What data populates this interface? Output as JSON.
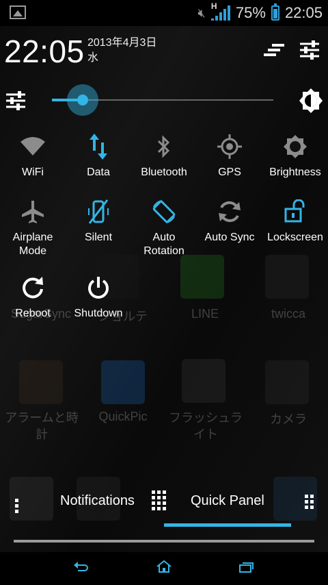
{
  "status_bar": {
    "battery_percent": "75%",
    "time": "22:05",
    "network_type": "H",
    "icons": [
      "gallery-icon",
      "muted-icon",
      "signal-icon",
      "battery-icon"
    ]
  },
  "header": {
    "clock": "22:05",
    "date": "2013年4月3日",
    "weekday": "水"
  },
  "brightness": {
    "level": 0.14,
    "icons": [
      "settings-sliders-icon",
      "brightness-auto-icon"
    ]
  },
  "toggles_row1": [
    {
      "label": "WiFi",
      "icon": "wifi-icon",
      "state": "off"
    },
    {
      "label": "Data",
      "icon": "data-icon",
      "state": "on"
    },
    {
      "label": "Bluetooth",
      "icon": "bluetooth-icon",
      "state": "off"
    },
    {
      "label": "GPS",
      "icon": "gps-icon",
      "state": "off"
    },
    {
      "label": "Brightness",
      "icon": "brightness-icon",
      "state": "off"
    }
  ],
  "toggles_row2": [
    {
      "label": "Airplane Mode",
      "icon": "airplane-icon",
      "state": "off"
    },
    {
      "label": "Silent",
      "icon": "silent-icon",
      "state": "on"
    },
    {
      "label": "Auto Rotation",
      "icon": "rotation-icon",
      "state": "on"
    },
    {
      "label": "Auto Sync",
      "icon": "sync-icon",
      "state": "off"
    },
    {
      "label": "Lockscreen",
      "icon": "lock-icon",
      "state": "on"
    }
  ],
  "toggles_row3": [
    {
      "label": "Reboot",
      "icon": "reboot-icon"
    },
    {
      "label": "Shutdown",
      "icon": "power-icon"
    }
  ],
  "background_apps": {
    "row1": [
      "SugarSync",
      "ジョルテ",
      "LINE",
      "twicca"
    ],
    "row2": [
      "アラームと時計",
      "QuickPic",
      "フラッシュライト",
      "カメラ"
    ]
  },
  "tabs": {
    "notifications": "Notifications",
    "quick_panel": "Quick Panel",
    "active": "quick_panel"
  },
  "colors": {
    "accent": "#33b5e5",
    "inactive_icon": "#8c8c8c"
  }
}
